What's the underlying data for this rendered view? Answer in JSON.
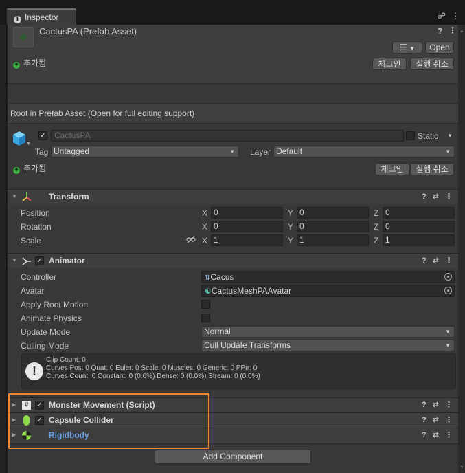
{
  "window": {
    "tab_label": "Inspector",
    "tab_icons": [
      "lock-icon",
      "menu-icon"
    ]
  },
  "asset": {
    "title": "CactusPA (Prefab Asset)",
    "open_label": "Open",
    "added_label": "추가됨",
    "check_in_label": "체크인",
    "undo_checkout_label": "실행 취소"
  },
  "notice": "Root in Prefab Asset (Open for full editing support)",
  "gameobject": {
    "active": true,
    "name": "CactusPA",
    "static_label": "Static",
    "tag_label": "Tag",
    "tag_value": "Untagged",
    "layer_label": "Layer",
    "layer_value": "Default",
    "added_label": "추가됨",
    "check_in_label": "체크인",
    "undo_checkout_label": "실행 취소"
  },
  "transform": {
    "title": "Transform",
    "position_label": "Position",
    "rotation_label": "Rotation",
    "scale_label": "Scale",
    "x_label": "X",
    "y_label": "Y",
    "z_label": "Z",
    "position": [
      "0",
      "0",
      "0"
    ],
    "rotation": [
      "0",
      "0",
      "0"
    ],
    "scale": [
      "1",
      "1",
      "1"
    ]
  },
  "animator": {
    "title": "Animator",
    "enabled": true,
    "controller_label": "Controller",
    "controller_value": "Cacus",
    "avatar_label": "Avatar",
    "avatar_value": "CactusMeshPAAvatar",
    "apply_root_motion_label": "Apply Root Motion",
    "apply_root_motion": false,
    "animate_physics_label": "Animate Physics",
    "animate_physics": false,
    "update_mode_label": "Update Mode",
    "update_mode_value": "Normal",
    "culling_mode_label": "Culling Mode",
    "culling_mode_value": "Cull Update Transforms",
    "info": {
      "line1": "Clip Count: 0",
      "line2": "Curves Pos: 0 Quat: 0 Euler: 0 Scale: 0 Muscles: 0 Generic: 0 PPtr: 0",
      "line3": "Curves Count: 0 Constant: 0 (0.0%) Dense: 0 (0.0%) Stream: 0 (0.0%)"
    }
  },
  "components": [
    {
      "title": "Monster Movement (Script)",
      "enabled": true
    },
    {
      "title": "Capsule Collider",
      "enabled": true
    },
    {
      "title": "Rigidbody"
    }
  ],
  "add_component_label": "Add Component",
  "colors": {
    "highlight": "#f0882d",
    "added_link": "#6d9ee0",
    "plus_green": "#3cb043"
  }
}
